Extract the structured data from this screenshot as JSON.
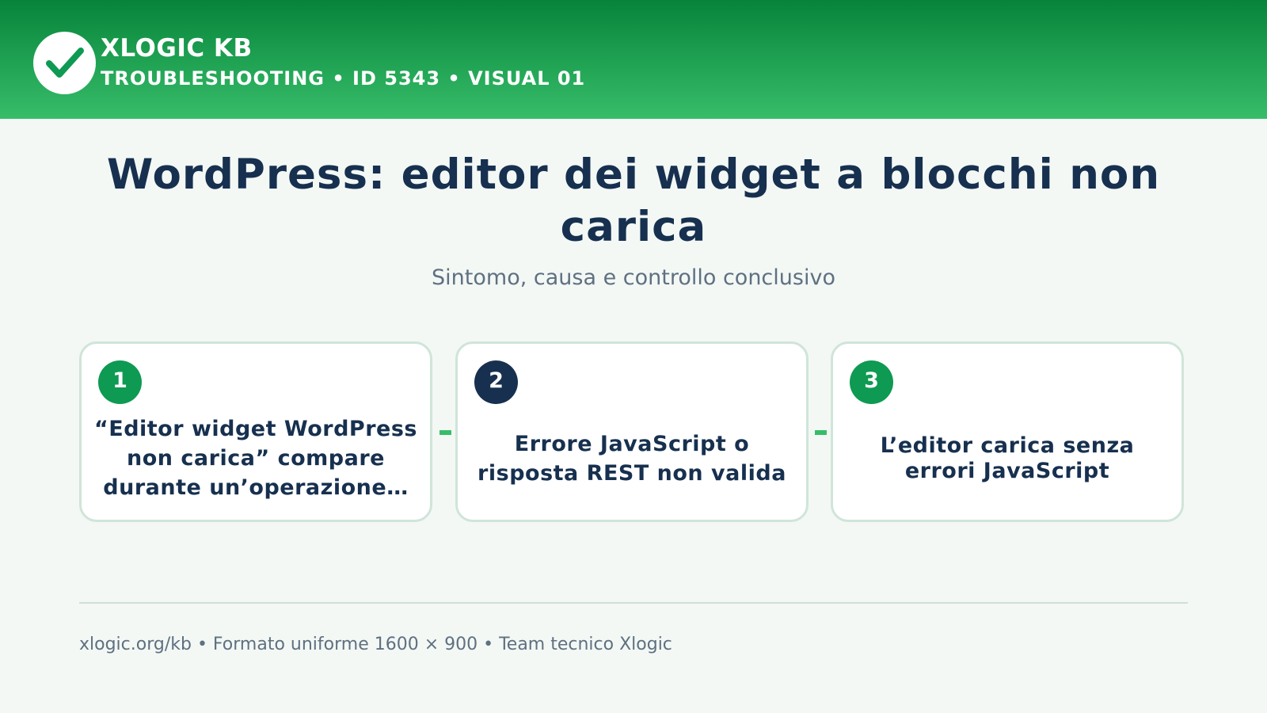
{
  "header": {
    "brand": "XLOGIC KB",
    "subtitle": "TROUBLESHOOTING • ID 5343 • VISUAL 01",
    "logo_icon": "checkmark-icon"
  },
  "main": {
    "title": "WordPress: editor dei widget a blocchi non carica",
    "subtitle": "Sintomo, causa e controllo conclusivo"
  },
  "steps": [
    {
      "number": "1",
      "text": "“Editor widget WordPress non carica” compare durante un’operazione…",
      "badge_color": "#0e9a52"
    },
    {
      "number": "2",
      "text": "Errore JavaScript o risposta REST non valida",
      "badge_color": "#17304f"
    },
    {
      "number": "3",
      "text": "L’editor carica senza errori JavaScript",
      "badge_color": "#0e9a52"
    }
  ],
  "footer": {
    "text": "xlogic.org/kb • Formato uniforme 1600 × 900 • Team tecnico Xlogic"
  },
  "colors": {
    "brand_green": "#07843a",
    "accent_green": "#37bd6a",
    "navy": "#17304f",
    "muted_text": "#5f7080",
    "background": "#f3f8f5"
  }
}
